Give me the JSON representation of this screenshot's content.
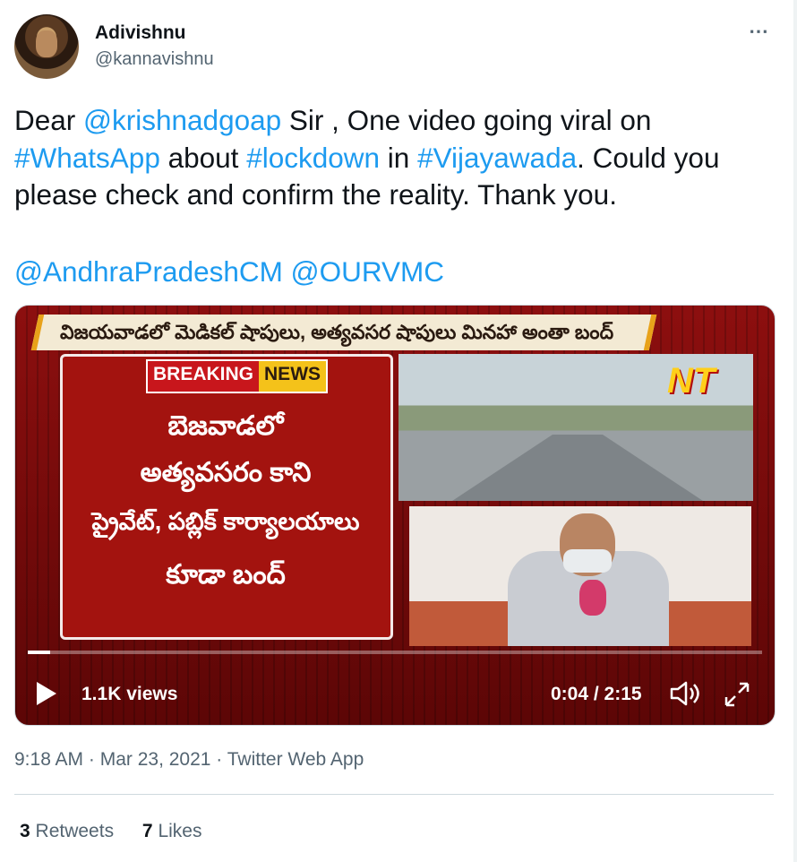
{
  "user": {
    "name": "Adivishnu",
    "handle": "@kannavishnu"
  },
  "more_icon": "⋯",
  "tweet": {
    "p1": "Dear ",
    "m1": "@krishnadgoap",
    "p2": " Sir , One video going viral on ",
    "h1": "#WhatsApp",
    "p3": " about ",
    "h2": "#lockdown",
    "p4": " in ",
    "h3": "#Vijayawada",
    "p5": ". Could you please check and confirm the reality. Thank you.",
    "m2": "@AndhraPradeshCM",
    "m3": "@OURVMC"
  },
  "video": {
    "ticker": "విజయవాడలో మెడికల్ షాపులు, అత్యవసర షాపులు మినహా అంతా బంద్",
    "badge_left": "BREAKING",
    "badge_right": "NEWS",
    "line1": "బెజవాడలో",
    "line2": "అత్యవసరం కాని",
    "line3": "ప్రైవేట్, పబ్లిక్ కార్యాలయాలు",
    "line4": "కూడా బంద్",
    "channel_logo": "NT",
    "views": "1.1K views",
    "time": "0:04 / 2:15",
    "progress": 0.03
  },
  "meta": "9:18 AM · Mar 23, 2021 · Twitter Web App",
  "stats": {
    "retweets_count": "3",
    "retweets_label": "Retweets",
    "likes_count": "7",
    "likes_label": "Likes"
  },
  "colors": {
    "link": "#1d9bf0",
    "muted": "#536471"
  }
}
